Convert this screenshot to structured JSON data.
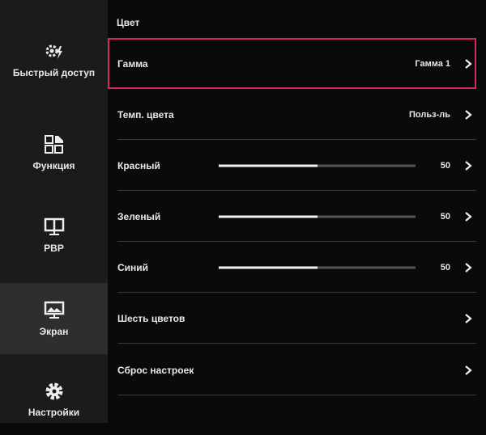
{
  "sidebar": {
    "items": [
      {
        "label": "Быстрый доступ",
        "icon": "quick-access-icon",
        "active": false
      },
      {
        "label": "Функция",
        "icon": "function-icon",
        "active": false
      },
      {
        "label": "PBP",
        "icon": "pbp-icon",
        "active": false
      },
      {
        "label": "Экран",
        "icon": "screen-icon",
        "active": true
      },
      {
        "label": "Настройки",
        "icon": "settings-icon",
        "active": false
      }
    ]
  },
  "main": {
    "section_title": "Цвет",
    "rows": [
      {
        "label": "Гамма",
        "value": "Гамма 1"
      },
      {
        "label": "Темп. цвета",
        "value": "Польз-ль"
      },
      {
        "label": "Красный",
        "value": "50",
        "slider": 50
      },
      {
        "label": "Зеленый",
        "value": "50",
        "slider": 50
      },
      {
        "label": "Синий",
        "value": "50",
        "slider": 50
      },
      {
        "label": "Шесть цветов"
      },
      {
        "label": "Сброс настроек"
      }
    ]
  },
  "colors": {
    "focus": "#d4266a",
    "sidebar_bg": "#1c1b1c",
    "active_bg": "#2f2e2f"
  }
}
